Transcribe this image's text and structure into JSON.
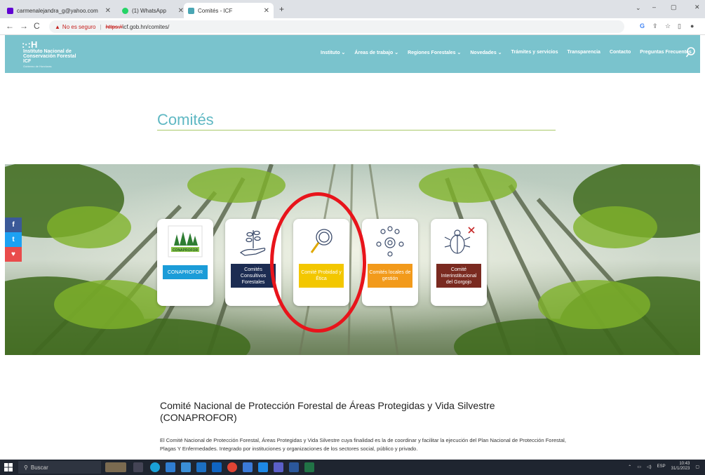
{
  "browser": {
    "tabs": [
      {
        "label": "carmenalejandra_g@yahoo.com",
        "favicon_color": "#6001d2"
      },
      {
        "label": "(1) WhatsApp",
        "favicon_color": "#25d366"
      },
      {
        "label": "Comités - ICF",
        "favicon_color": "#4aa6b4",
        "active": true
      }
    ],
    "new_tab": "+",
    "window_controls": [
      "⌄",
      "–",
      "▢",
      "✕"
    ],
    "security_label": "No es seguro",
    "url_proto": "https://",
    "url_host": "icf.gob.hn/comites/",
    "extensions": [
      "G",
      "⇪",
      "☆",
      "▯",
      "●"
    ]
  },
  "site": {
    "logo_mark": ":·:H",
    "logo_lines": [
      "Instituto Nacional de",
      "Conservación Forestal",
      "ICF"
    ],
    "logo_tag": "Gobierno de Honduras",
    "nav": [
      "Instituto ⌄",
      "Áreas de trabajo ⌄",
      "Regiones Forestales ⌄",
      "Novedades ⌄",
      "Trámites y servicios",
      "Transparencia",
      "Contacto",
      "Preguntas Frecuentes"
    ]
  },
  "page_title": "Comités",
  "social": [
    {
      "label": "f",
      "color": "#3b5998"
    },
    {
      "label": "t",
      "color": "#1da1f2"
    },
    {
      "label": "♥",
      "color": "#e94b4b"
    }
  ],
  "committees": [
    {
      "label": "CONAPROFOR",
      "color": "#1b9cd8",
      "icon": "conaprofor-logo",
      "logo_text": "CONAPROFOR"
    },
    {
      "label": "Comités Consultivos Forestales",
      "color": "#1c2c52",
      "icon": "hand-plant-icon"
    },
    {
      "label": "Comité Probidad y Ética",
      "color": "#f3c700",
      "icon": "magnifier-icon"
    },
    {
      "label": "Comités locales de gestión",
      "color": "#f29a1b",
      "icon": "people-gear-icon"
    },
    {
      "label": "Comité Interinstitucional del Gorgojo",
      "color": "#7a2a20",
      "icon": "beetle-icon"
    }
  ],
  "article": {
    "title": "Comité Nacional de Protección Forestal de Áreas Protegidas y Vida Silvestre (CONAPROFOR)",
    "body": "El Comité Nacional de Protección Forestal, Áreas Protegidas y Vida Silvestre cuya finalidad es la de coordinar y facilitar la ejecución del Plan Nacional de Protección Forestal, Plagas Y Enfermedades. Integrado por instituciones y organizaciones de los sectores social, público y privado."
  },
  "taskbar": {
    "search": "Buscar",
    "lang": "ESP",
    "time": "10:43",
    "date": "31/1/2023"
  }
}
